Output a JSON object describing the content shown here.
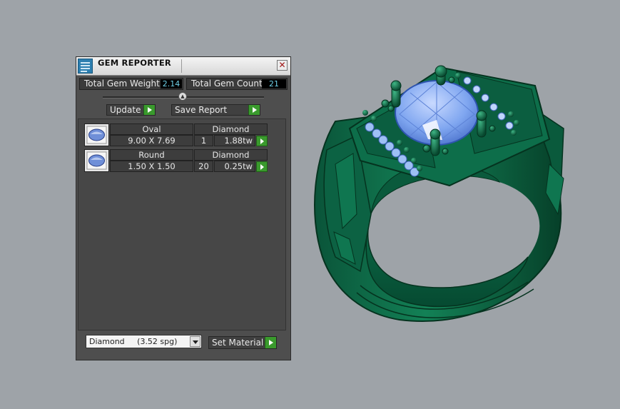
{
  "panel": {
    "title": "GEM REPORTER",
    "close_icon": "close-icon",
    "app_icon": "gem-reporter-app-icon"
  },
  "stats": {
    "total_weight_label": "Total Gem Weight",
    "total_weight_value": "2.14",
    "total_count_label": "Total Gem Count",
    "total_count_value": "21"
  },
  "actions": {
    "update_label": "Update",
    "save_report_label": "Save Report"
  },
  "gems": [
    {
      "shape": "Oval",
      "size": "9.00 X 7.69",
      "material": "Diamond",
      "count": "1",
      "weight": "1.88tw"
    },
    {
      "shape": "Round",
      "size": "1.50 X 1.50",
      "material": "Diamond",
      "count": "20",
      "weight": "0.25tw"
    }
  ],
  "material": {
    "selected": "Diamond     (3.52 spg)",
    "set_label": "Set Material"
  },
  "colors": {
    "ring": "#0e6b49",
    "gem": "#7fa6f0",
    "accent_green": "#3a9a2d",
    "value_text": "#6fd1e8"
  }
}
